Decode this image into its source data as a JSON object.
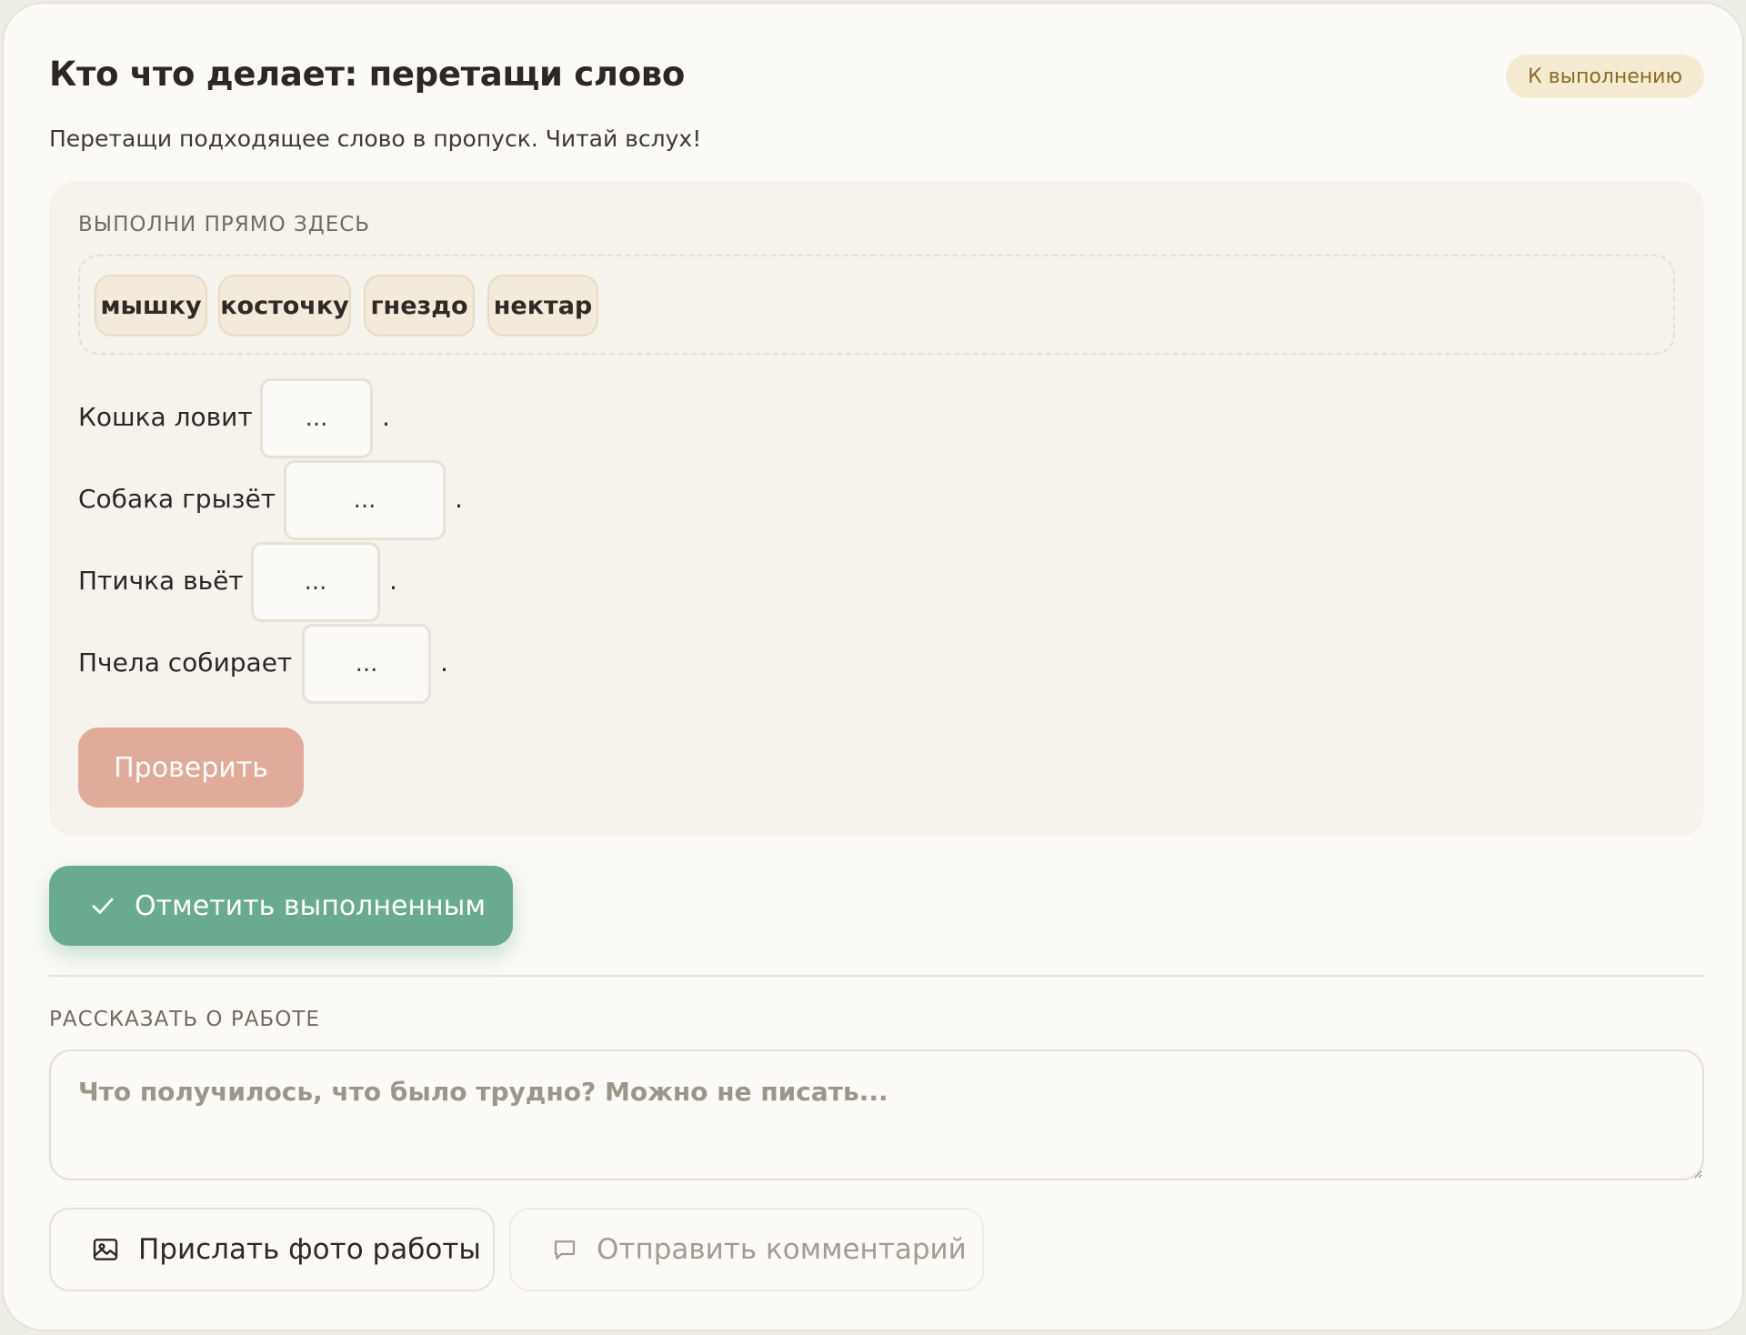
{
  "task": {
    "title": "Кто что делает: перетащи слово",
    "status": "К выполнению",
    "instruction": "Перетащи подходящее слово в пропуск. Читай вслух!"
  },
  "exercise": {
    "section_label": "ВЫПОЛНИ ПРЯМО ЗДЕСЬ",
    "word_bank": [
      "мышку",
      "косточку",
      "гнездо",
      "нектар"
    ],
    "sentences": [
      {
        "prefix": "Кошка ловит",
        "slot": "...",
        "suffix": "."
      },
      {
        "prefix": "Собака грызёт",
        "slot": "...",
        "suffix": "."
      },
      {
        "prefix": "Птичка вьёт",
        "slot": "...",
        "suffix": "."
      },
      {
        "prefix": "Пчела собирает",
        "slot": "...",
        "suffix": "."
      }
    ],
    "check_label": "Проверить"
  },
  "mark_done": {
    "label": "Отметить выполненным",
    "icon": "check-icon"
  },
  "feedback": {
    "section_label": "РАССКАЗАТЬ О РАБОТЕ",
    "placeholder": "Что получилось, что было трудно? Можно не писать...",
    "value": ""
  },
  "actions": {
    "photo_label": "Прислать фото работы",
    "photo_icon": "image-icon",
    "comment_label": "Отправить комментарий",
    "comment_icon": "comment-icon"
  },
  "colors": {
    "check_button": "#e0ab9a",
    "mark_done_button": "#6aab8f",
    "status_badge_bg": "#f5ebd2",
    "status_badge_text": "#8a6a26"
  }
}
